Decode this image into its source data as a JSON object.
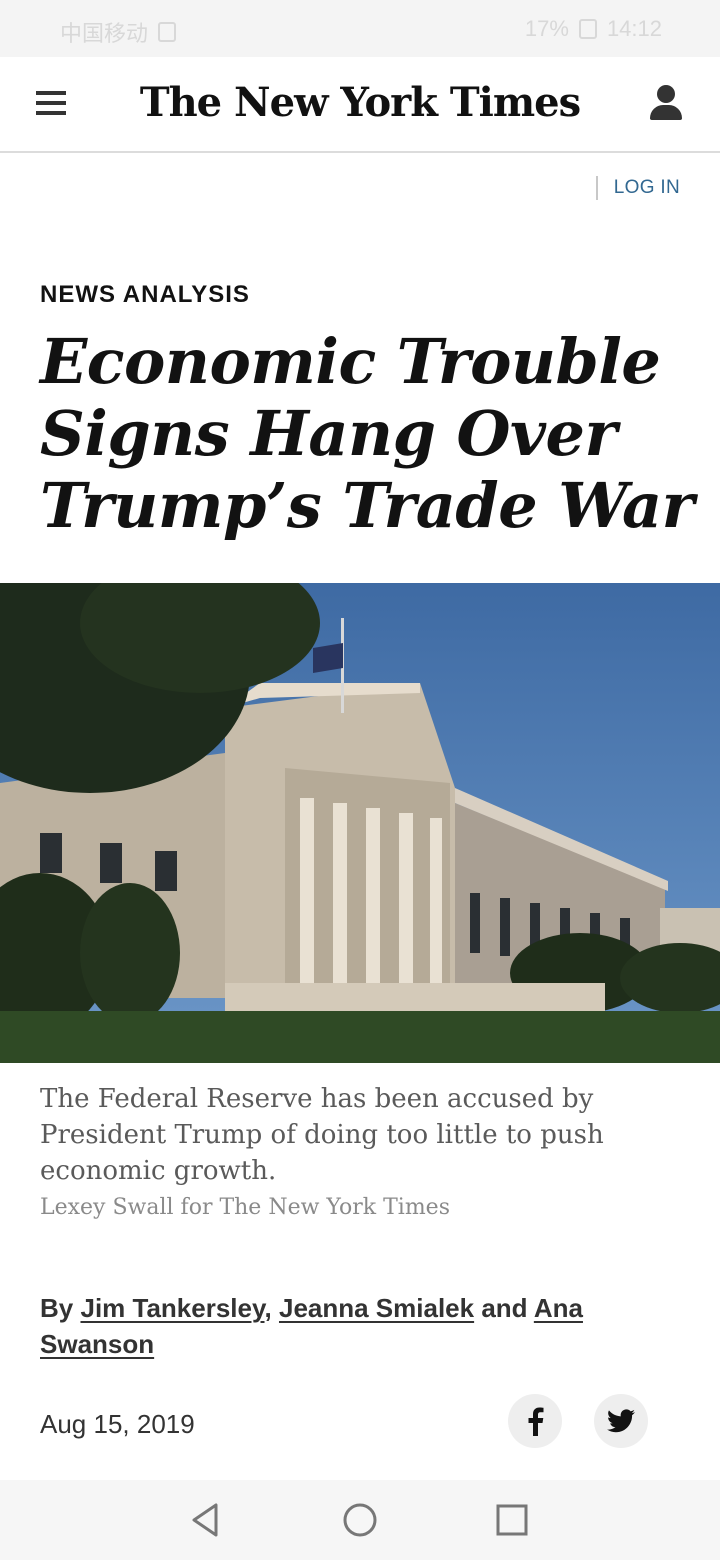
{
  "status_bar": {
    "left_text": "中国移动",
    "right_text": "17%",
    "time": "14:12"
  },
  "header": {
    "logo": "The New York Times",
    "login_label": "LOG IN"
  },
  "article": {
    "kicker": "NEWS ANALYSIS",
    "headline": "Economic Trouble Signs Hang Over Trump’s Trade War",
    "caption": "The Federal Reserve has been accused by President Trump of doing too little to push economic growth.",
    "credit": "Lexey Swall for The New York Times",
    "byline_prefix": "By",
    "authors": [
      "Jim Tankersley",
      "Jeanna Smialek",
      "Ana Swanson"
    ],
    "byline_sep_1": ",",
    "byline_and": "and",
    "date": "Aug 15, 2019"
  },
  "share": {
    "facebook_icon": "facebook-icon",
    "twitter_icon": "twitter-icon"
  },
  "nav": {
    "back_icon": "back-triangle-icon",
    "home_icon": "home-circle-icon",
    "recent_icon": "recent-square-icon"
  },
  "colors": {
    "link_blue": "#326891",
    "text_dark": "#121212",
    "caption_gray": "#5a5a5a"
  }
}
